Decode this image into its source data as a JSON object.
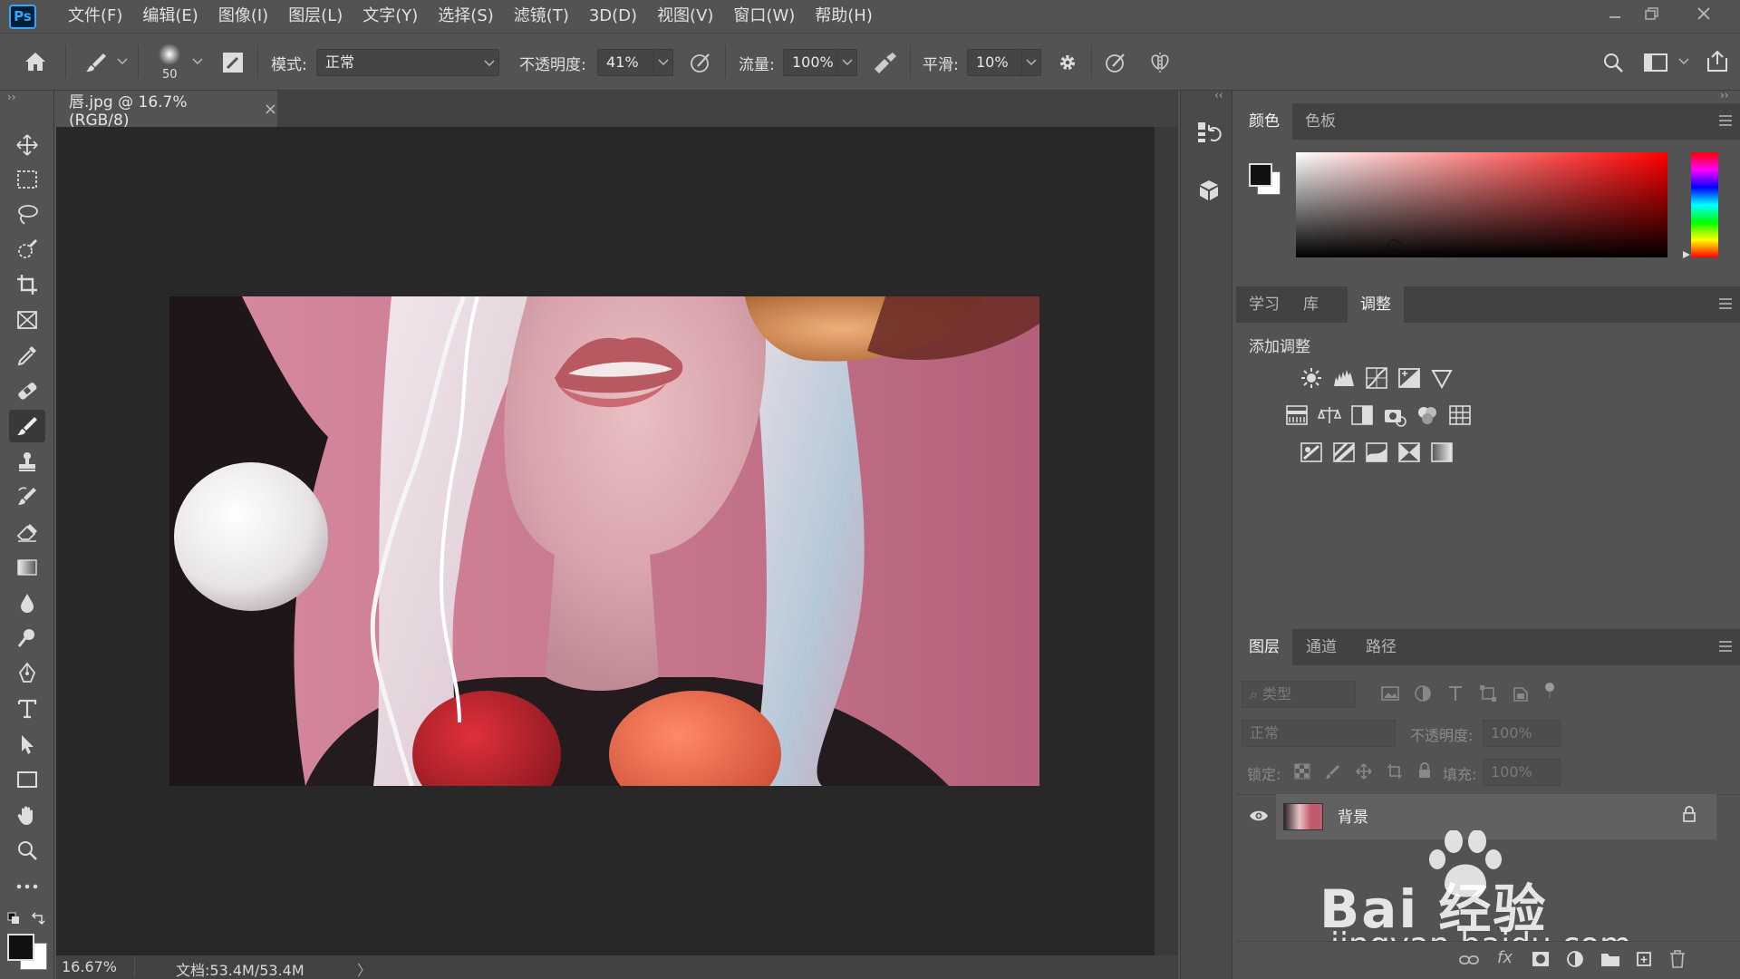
{
  "app": {
    "logo": "Ps"
  },
  "menu": [
    "文件(F)",
    "编辑(E)",
    "图像(I)",
    "图层(L)",
    "文字(Y)",
    "选择(S)",
    "滤镜(T)",
    "3D(D)",
    "视图(V)",
    "窗口(W)",
    "帮助(H)"
  ],
  "options": {
    "brush_size": "50",
    "mode_label": "模式:",
    "mode_value": "正常",
    "opacity_label": "不透明度:",
    "opacity_value": "41%",
    "flow_label": "流量:",
    "flow_value": "100%",
    "smooth_label": "平滑:",
    "smooth_value": "10%"
  },
  "document": {
    "tab_title": "唇.jpg @ 16.7%(RGB/8)",
    "close": "×",
    "zoom": "16.67%",
    "doc_info": "文档:53.4M/53.4M",
    "expand": "〉"
  },
  "color_panel": {
    "tabs": [
      "颜色",
      "色板"
    ],
    "active_tab": 0,
    "foreground": "#111111",
    "background": "#ffffff",
    "hue": "#ff0000"
  },
  "adjust_panel": {
    "tabs": [
      "学习",
      "库",
      "调整"
    ],
    "active_tab": 2,
    "heading": "添加调整",
    "row1": [
      "brightness-contrast-icon",
      "levels-icon",
      "curves-icon",
      "exposure-icon",
      "vibrance-icon"
    ],
    "row2": [
      "hue-saturation-icon",
      "color-balance-icon",
      "black-white-icon",
      "photo-filter-icon",
      "channel-mixer-icon",
      "color-lookup-icon"
    ],
    "row3": [
      "invert-icon",
      "posterize-icon",
      "threshold-icon",
      "selective-color-icon",
      "gradient-map-icon"
    ]
  },
  "layers_panel": {
    "tabs": [
      "图层",
      "通道",
      "路径"
    ],
    "active_tab": 0,
    "filter_placeholder": "类型",
    "blend_mode": "正常",
    "opacity_label": "不透明度:",
    "opacity_value": "100%",
    "lock_label": "锁定:",
    "fill_label": "填充:",
    "fill_value": "100%",
    "layers": [
      {
        "name": "背景",
        "visible": true,
        "locked": true
      }
    ]
  },
  "watermark": {
    "brand": "Bai 经验",
    "url": "jingyan.baidu.com"
  }
}
